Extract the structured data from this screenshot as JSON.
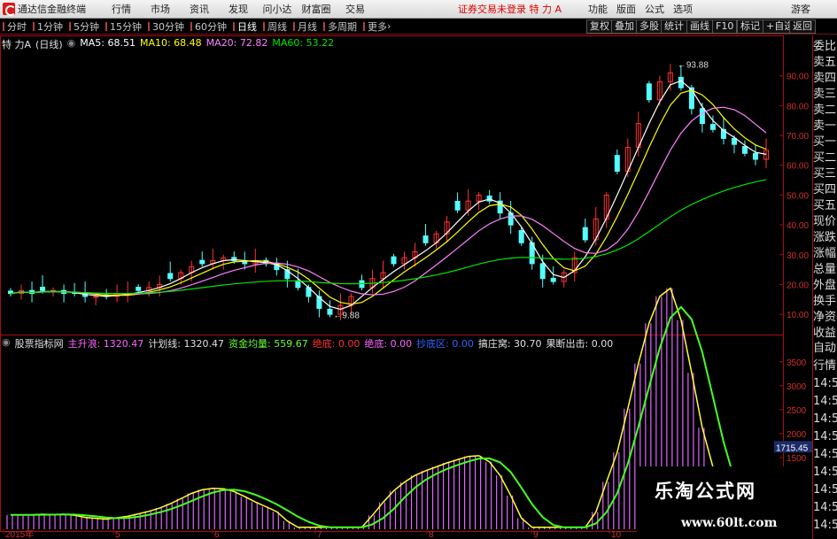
{
  "titlebar": {
    "app_title": "通达信金融终端",
    "menu": [
      "行情",
      "市场",
      "资讯",
      "发现",
      "问小达",
      "财富圈",
      "交易"
    ],
    "notice": "证券交易未登录  特 力 A",
    "right_tools": [
      "功能",
      "版面",
      "公式",
      "选项"
    ],
    "guest": "游客"
  },
  "toolbar": {
    "periods": [
      "分时",
      "1分钟",
      "5分钟",
      "15分钟",
      "30分钟",
      "60分钟",
      "日线",
      "周线",
      "月线",
      "多周期",
      "更多"
    ],
    "active_period": "日线",
    "right_buttons": [
      "复权",
      "叠加",
      "多股",
      "统计",
      "画线",
      "F10",
      "标记",
      "+自选",
      "返回"
    ]
  },
  "main_info": {
    "name": "特 力A",
    "period": "(日线)",
    "ma5": "MA5: 68.51",
    "ma10": "MA10: 68.48",
    "ma20": "MA20: 72.82",
    "ma60": "MA60: 53.22"
  },
  "indicator_info": {
    "name": "股票指标网",
    "main_up": "主升浪: 1320.47",
    "plan": "计划线: 1320.47",
    "fund": "资金均量: 559.67",
    "bottom": "绝底: 0.00",
    "deep": "绝底: 0.00",
    "escape": "抄底区: 0.00",
    "dealer": "搞庄窝: 30.70",
    "exit": "果断出击: 0.00"
  },
  "side_panel_top": [
    "委比",
    "卖五",
    "卖四",
    "卖三",
    "卖二",
    "卖一",
    "买一",
    "买二",
    "买三",
    "买四",
    "买五",
    "现价",
    "涨跌",
    "涨幅",
    "总量",
    "外盘",
    "换手",
    "净资",
    "收益"
  ],
  "side_panel_bottom": [
    "自动",
    "行情",
    "14:50",
    "14:50",
    "14:50",
    "14:50",
    "14:50",
    "14:50",
    "14:50",
    "14:50",
    "14:50"
  ],
  "price_axis": [
    "90.00",
    "80.00",
    "70.00",
    "60.00",
    "50.00",
    "40.00",
    "30.00",
    "20.00",
    "10.00"
  ],
  "ind_axis": [
    "3500",
    "3000",
    "2500",
    "2000",
    "1715.45",
    "1500"
  ],
  "date_axis": [
    "2015年",
    "5",
    "6",
    "7",
    "8",
    "9",
    "10"
  ],
  "annotations": {
    "high": "93.88",
    "low": "9.88"
  },
  "watermark": {
    "title": "乐淘公式网",
    "url": "www.60lt.com"
  },
  "colors": {
    "up": "#ff3232",
    "down": "#54ffff",
    "ma5": "#ffffff",
    "ma10": "#ffff00",
    "ma20": "#ff80ff",
    "ma60": "#00e600",
    "bar": "#e066ff",
    "frame": "#a01010"
  },
  "chart_data": {
    "type": "candlestick",
    "ylim": [
      5,
      100
    ],
    "close": [
      17,
      18,
      17,
      18,
      18,
      17,
      17,
      16,
      16,
      16,
      17,
      17,
      18,
      19,
      20,
      22,
      24,
      26,
      27,
      28,
      29,
      28,
      27,
      28,
      27,
      25,
      22,
      19,
      16,
      12,
      10,
      13,
      16,
      19,
      22,
      24,
      27,
      29,
      31,
      34,
      37,
      41,
      45,
      48,
      50,
      48,
      44,
      40,
      34,
      27,
      22,
      21,
      24,
      29,
      35,
      42,
      50,
      58,
      66,
      74,
      82,
      88,
      91,
      86,
      79,
      74,
      72,
      69,
      67,
      64,
      62,
      65
    ],
    "ma_note": "MA values derived from close"
  }
}
